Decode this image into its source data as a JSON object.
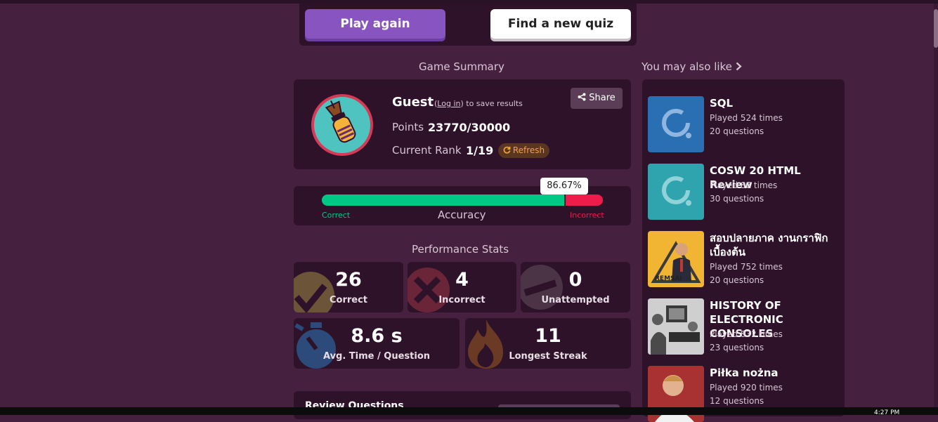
{
  "actions": {
    "play_again": "Play again",
    "find_new_quiz": "Find a new quiz"
  },
  "summary": {
    "title": "Game Summary",
    "guest_name": "Guest",
    "login_open": "(",
    "login_link": "Log in",
    "login_close": ") to save results",
    "points_label": "Points",
    "points_value": "23770/30000",
    "rank_label": "Current Rank",
    "rank_value": "1/19",
    "share_label": "Share",
    "refresh_label": "Refresh"
  },
  "accuracy": {
    "label": "Accuracy",
    "percent_text": "86.67%",
    "percent": 86.67,
    "correct_label": "Correct",
    "incorrect_label": "Incorrect"
  },
  "performance": {
    "title": "Performance Stats",
    "correct": {
      "value": "26",
      "label": "Correct"
    },
    "incorrect": {
      "value": "4",
      "label": "Incorrect"
    },
    "unattempted": {
      "value": "0",
      "label": "Unattempted"
    },
    "avg_time": {
      "value": "8.6 s",
      "label": "Avg. Time / Question"
    },
    "streak": {
      "value": "11",
      "label": "Longest Streak"
    }
  },
  "review": {
    "title": "Review Questions"
  },
  "sidebar": {
    "title": "You may also like",
    "items": [
      {
        "title": "SQL",
        "played": "Played 524 times",
        "questions": "20 questions"
      },
      {
        "title": "COSW 20 HTML Review",
        "played": "Played 88 times",
        "questions": "30 questions"
      },
      {
        "title": "สอบปลายภาค งานกราฟิกเบื้องต้น",
        "played": "Played 752 times",
        "questions": "20 questions"
      },
      {
        "title": "HISTORY OF ELECTRONIC CONSOLES",
        "played": "Played 832 times",
        "questions": "23 questions"
      },
      {
        "title": "Piłka nożna",
        "played": "Played 920 times",
        "questions": "12 questions"
      }
    ]
  },
  "thumb_text": {
    "remsai": "REMSAI"
  },
  "taskbar": {
    "clock": "4:27 PM"
  },
  "colors": {
    "background": "#46213f",
    "panel": "#2e1229",
    "primary": "#8854c0",
    "correct": "#00c985",
    "incorrect": "#ec1c4b",
    "refresh": "#f2a33a"
  }
}
